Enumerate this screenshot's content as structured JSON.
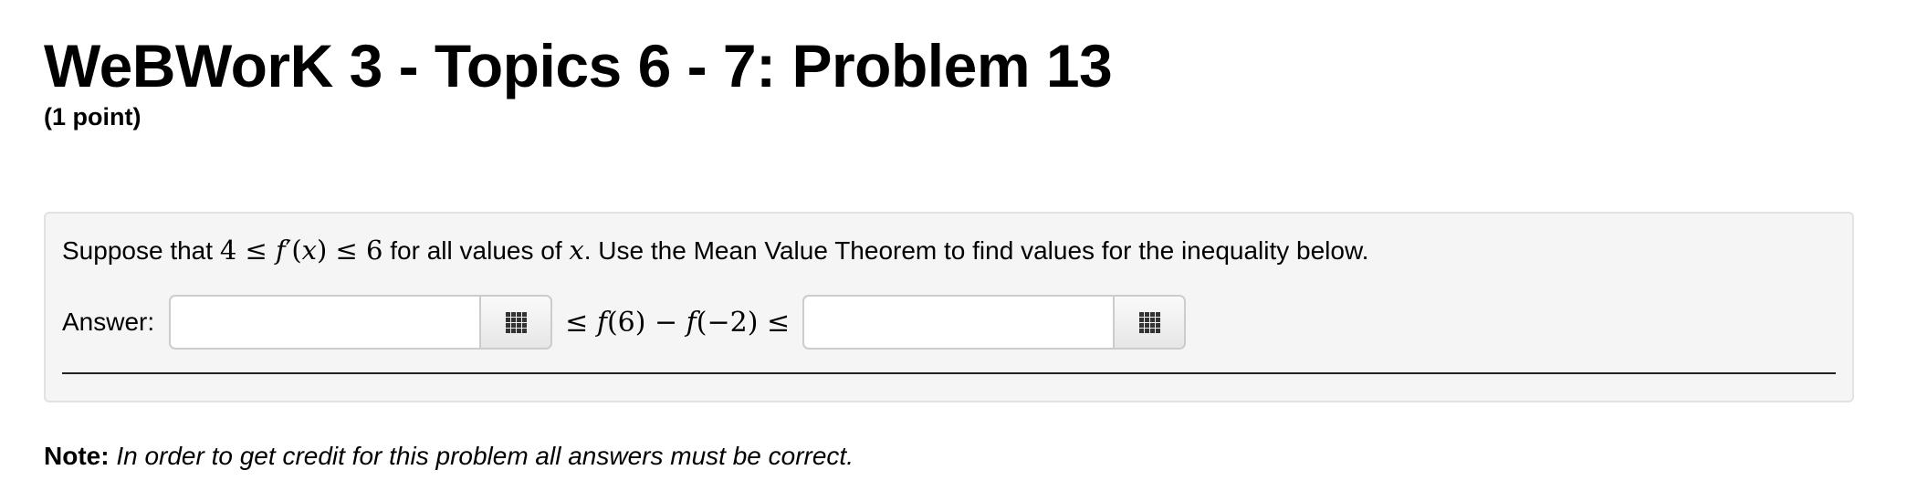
{
  "header": {
    "title": "WeBWorK 3 - Topics 6 - 7: Problem 13",
    "points": "(1 point)"
  },
  "problem": {
    "statement": {
      "prefix": "Suppose that ",
      "math_lower": "4 ≤ ",
      "math_f": "f",
      "math_prime_open": "′(",
      "math_x": "x",
      "math_upper": ") ≤ 6",
      "middle": " for all values of ",
      "var_x": "x",
      "suffix": ". Use the Mean Value Theorem to find values for the inequality below."
    },
    "answer": {
      "label": "Answer:",
      "input1_value": "",
      "input2_value": "",
      "expr_le1": "≤ ",
      "expr_f1": "f",
      "expr_arg1": "(6) − ",
      "expr_f2": "f",
      "expr_arg2": "(−2) ≤"
    },
    "palette_icon": "grid-icon"
  },
  "note": {
    "label": "Note:",
    "text": "In order to get credit for this problem all answers must be correct."
  }
}
